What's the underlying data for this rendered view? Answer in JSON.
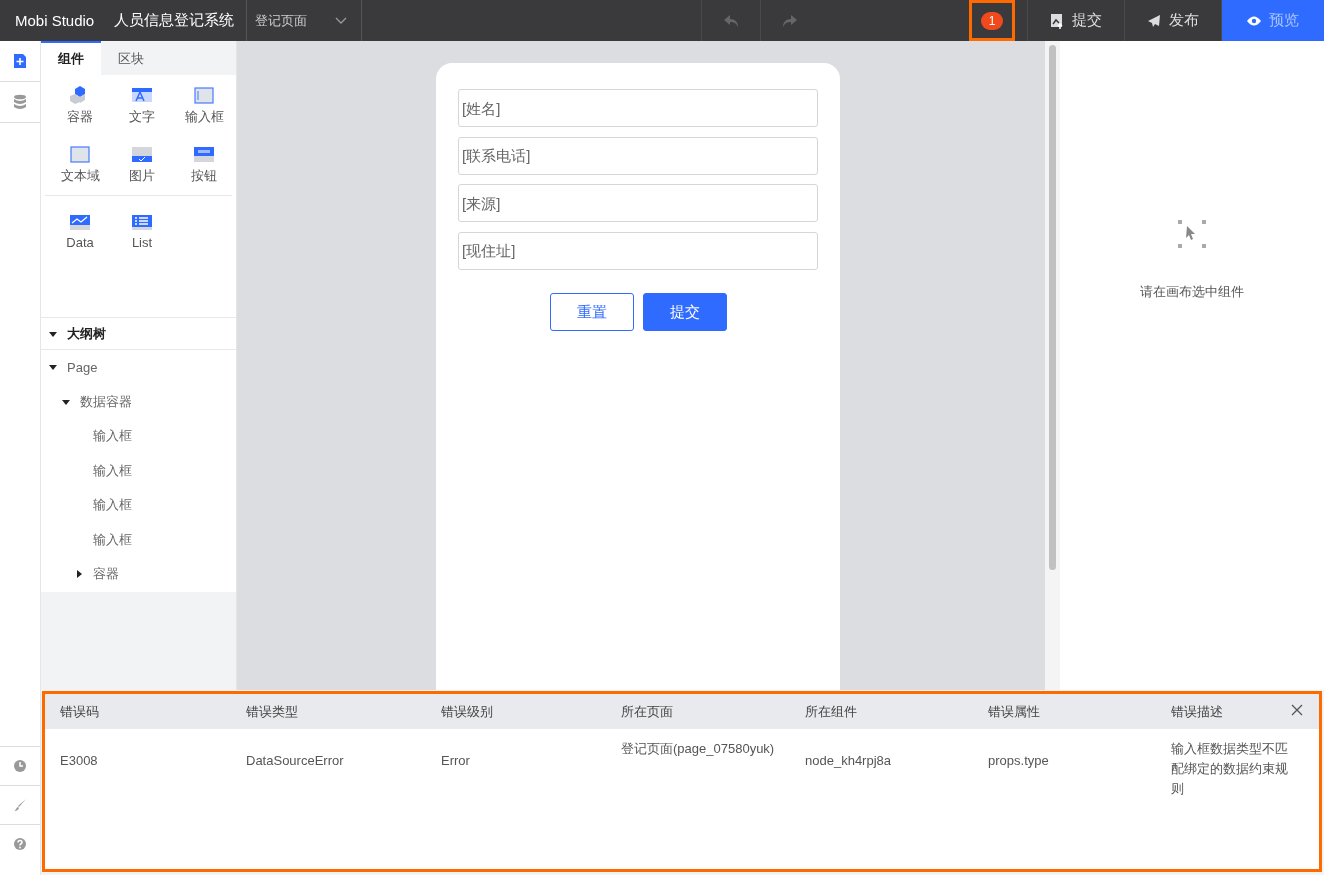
{
  "topbar": {
    "brand": "Mobi Studio",
    "app_name": "人员信息登记系统",
    "page_select": "登记页面",
    "error_count": "1",
    "buttons": [
      {
        "kind": "submit",
        "label": "提交"
      },
      {
        "kind": "publish",
        "label": "发布"
      },
      {
        "kind": "preview",
        "label": "预览"
      }
    ]
  },
  "rail": {
    "items": [
      {
        "kind": "add-page",
        "selected": true
      },
      {
        "kind": "database",
        "selected": false
      }
    ]
  },
  "panel_tabs": [
    {
      "label": "组件",
      "selected": true
    },
    {
      "label": "区块",
      "selected": false
    }
  ],
  "component_groups": [
    {
      "items": [
        {
          "kind": "container",
          "label": "容器"
        },
        {
          "kind": "text",
          "label": "文字"
        },
        {
          "kind": "input",
          "label": "输入框"
        },
        {
          "kind": "textarea",
          "label": "文本域"
        },
        {
          "kind": "image",
          "label": "图片"
        },
        {
          "kind": "button",
          "label": "按钮"
        }
      ]
    },
    {
      "items": [
        {
          "kind": "data",
          "label": "Data"
        },
        {
          "kind": "list",
          "label": "List"
        }
      ]
    }
  ],
  "outline": {
    "title": "大纲树",
    "expanded": true,
    "tree": [
      {
        "label": "Page",
        "expanded": true,
        "children": [
          {
            "label": "数据容器",
            "expanded": true,
            "children": [
              {
                "label": "输入框"
              },
              {
                "label": "输入框"
              },
              {
                "label": "输入框"
              },
              {
                "label": "输入框"
              },
              {
                "label": "容器",
                "expanded": false
              }
            ]
          }
        ]
      }
    ]
  },
  "canvas": {
    "fields": [
      {
        "placeholder": "[姓名]"
      },
      {
        "placeholder": "[联系电话]"
      },
      {
        "placeholder": "[来源]"
      },
      {
        "placeholder": "[现住址]"
      }
    ],
    "buttons": [
      {
        "kind": "outline",
        "label": "重置"
      },
      {
        "kind": "primary",
        "label": "提交"
      }
    ]
  },
  "properties": {
    "empty_text": "请在画布选中组件"
  },
  "error_panel": {
    "columns": [
      "错误码",
      "错误类型",
      "错误级别",
      "所在页面",
      "所在组件",
      "错误属性",
      "错误描述"
    ],
    "rows": [
      {
        "cells": [
          "E3008",
          "DataSourceError",
          "Error",
          "登记页面(page_07580yuk)",
          "node_kh4rpj8a",
          "props.type",
          "输入框数据类型不匹配绑定的数据约束规则"
        ]
      }
    ]
  }
}
